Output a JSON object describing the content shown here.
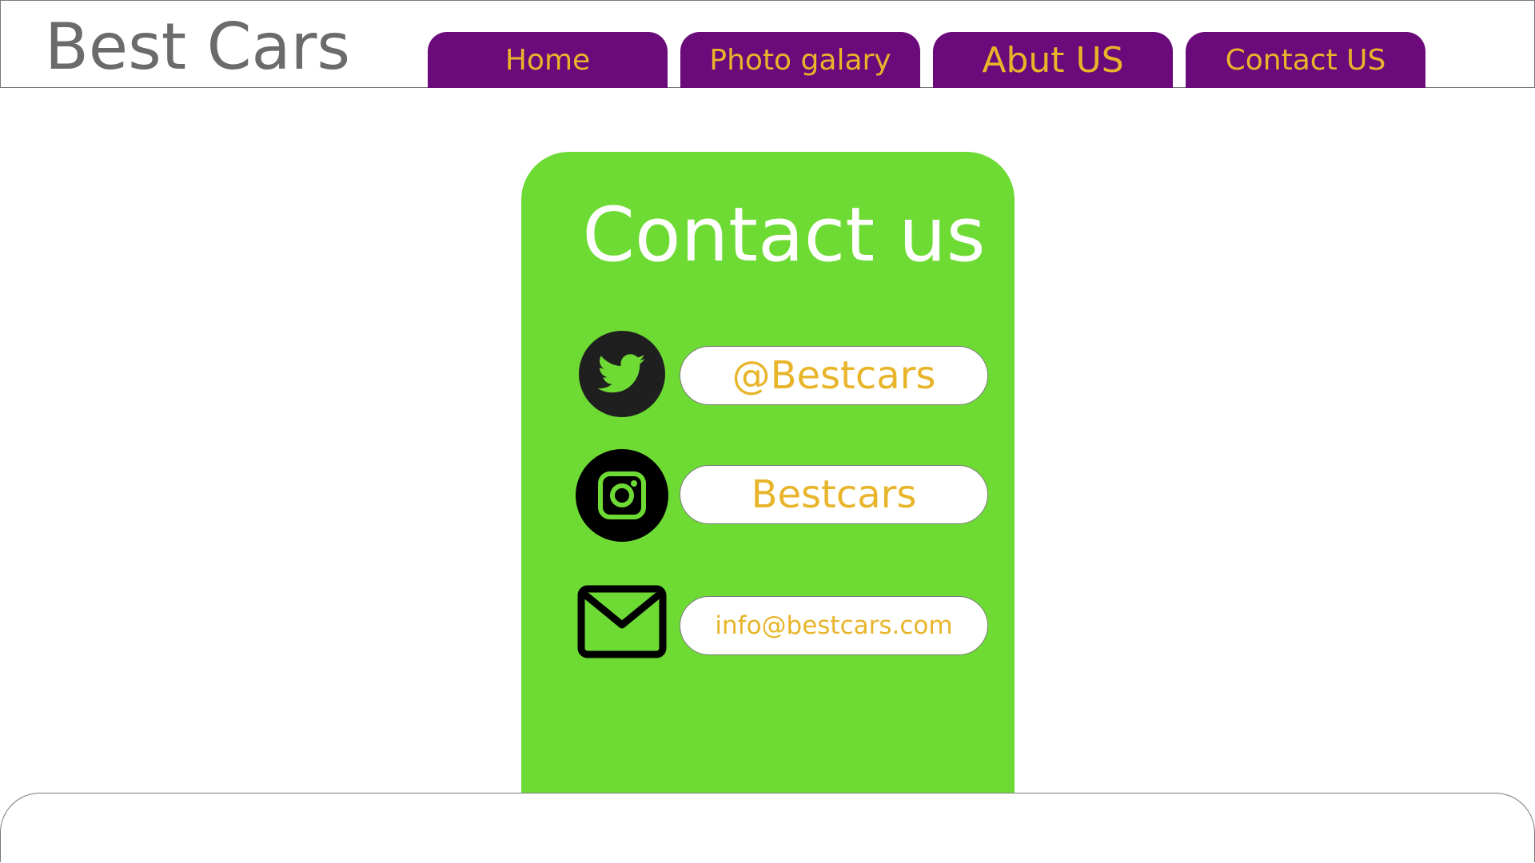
{
  "header": {
    "site_title": "Best Cars"
  },
  "nav": {
    "tabs": [
      {
        "label": "Home"
      },
      {
        "label": "Photo galary"
      },
      {
        "label": "Abut US"
      },
      {
        "label": "Contact US"
      }
    ]
  },
  "contact": {
    "title": "Contact us",
    "items": [
      {
        "icon": "twitter-icon",
        "value": "@Bestcars"
      },
      {
        "icon": "instagram-icon",
        "value": "Bestcars"
      },
      {
        "icon": "mail-icon",
        "value": "info@bestcars.com"
      }
    ]
  },
  "colors": {
    "nav_tab_bg": "#6b0a7a",
    "nav_tab_text": "#e8b52a",
    "card_bg": "#6edb35",
    "card_title": "#ffffff",
    "pill_text": "#e8b52a",
    "site_title": "#6b6b6b"
  }
}
